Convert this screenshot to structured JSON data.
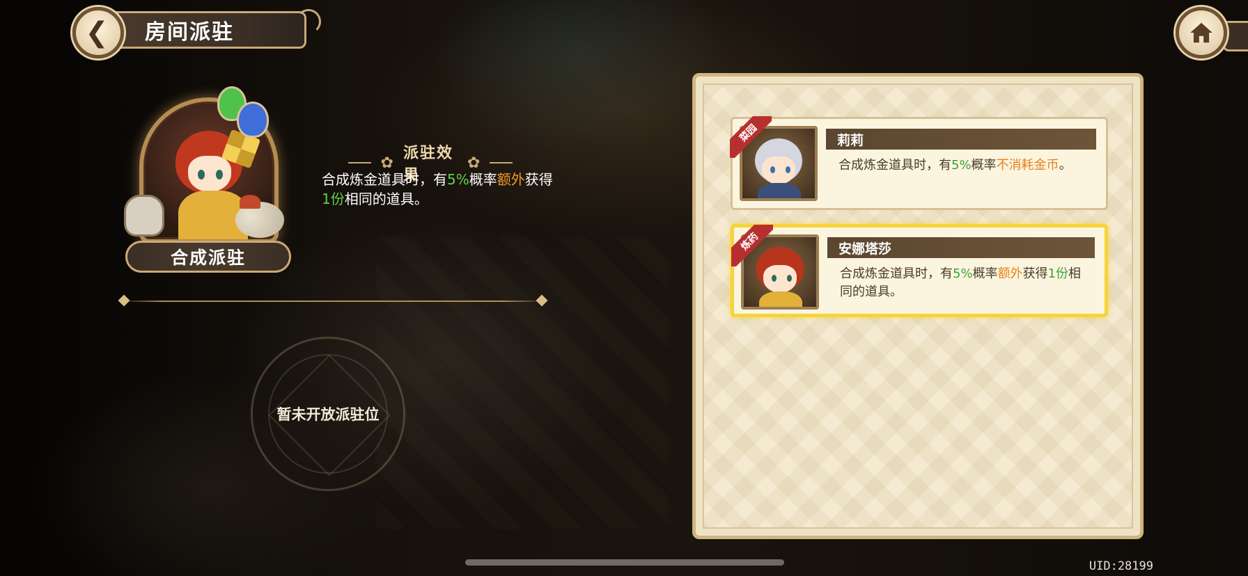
{
  "header": {
    "title": "房间派驻"
  },
  "dispatch": {
    "slot_label": "合成派驻",
    "effect_heading": "派驻效果",
    "effect_desc": {
      "p1": "合成炼金道具时，有",
      "pct": "5%",
      "p2": "概率",
      "extra": "额外",
      "p3": "获得",
      "count": "1份",
      "p4": "相同的道具。"
    },
    "locked_slot_text": "暂未开放派驻位"
  },
  "heroes": [
    {
      "name": "莉莉",
      "tag": "菜园",
      "desc": {
        "p1": "合成炼金道具时，有",
        "pct": "5%",
        "p2": "概率",
        "extra": "不消耗金币",
        "p3": "。"
      },
      "selected": false
    },
    {
      "name": "安娜塔莎",
      "tag": "炼药",
      "desc": {
        "p1": "合成炼金道具时，有",
        "pct": "5%",
        "p2": "概率",
        "extra": "额外",
        "p3": "获得",
        "count": "1份",
        "p4": "相同的道具。"
      },
      "selected": true
    }
  ],
  "footer": {
    "uid": "UID:28199"
  },
  "colors": {
    "highlight_green": "#5fd24a",
    "highlight_orange": "#f39b25",
    "selected_border": "#f6d33a",
    "ribbon_red": "#b82f2f"
  },
  "icons": [
    "back-arrow-icon",
    "home-icon"
  ]
}
